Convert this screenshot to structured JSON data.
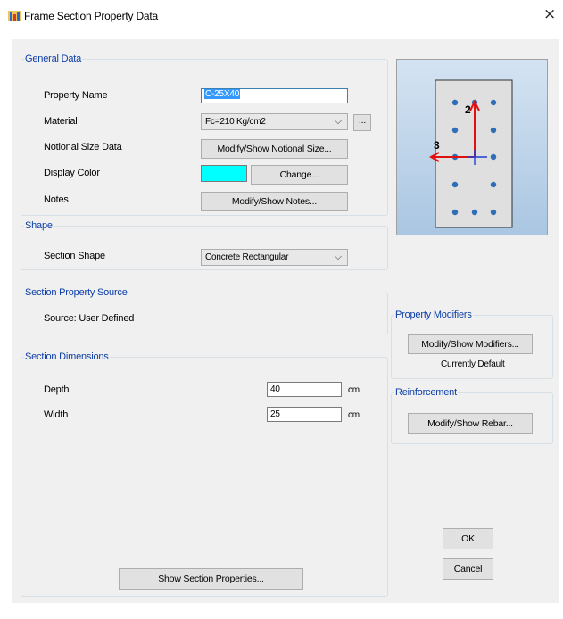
{
  "window": {
    "title": "Frame Section Property Data",
    "close": "×"
  },
  "general": {
    "legend": "General Data",
    "property_name_label": "Property Name",
    "property_name_value": "C-25X40",
    "material_label": "Material",
    "material_value": "Fc=210 Kg/cm2",
    "material_more": "...",
    "notional_label": "Notional Size Data",
    "notional_button": "Modify/Show Notional Size...",
    "display_color_label": "Display Color",
    "display_color_value": "#00ffff",
    "change_button": "Change...",
    "notes_label": "Notes",
    "notes_button": "Modify/Show Notes..."
  },
  "shape": {
    "legend": "Shape",
    "section_shape_label": "Section Shape",
    "section_shape_value": "Concrete Rectangular"
  },
  "source": {
    "legend": "Section Property Source",
    "text": "Source:  User Defined"
  },
  "dimensions": {
    "legend": "Section Dimensions",
    "depth_label": "Depth",
    "depth_value": "40",
    "depth_unit": "cm",
    "width_label": "Width",
    "width_value": "25",
    "width_unit": "cm",
    "show_properties_button": "Show Section Properties..."
  },
  "preview": {
    "axis_2_label": "2",
    "axis_3_label": "3",
    "colors": {
      "axis_2": "#e01010",
      "axis_3": "#e01010",
      "rebar": "#2e6db8",
      "origin": "#1f3fd1"
    }
  },
  "modifiers": {
    "legend": "Property Modifiers",
    "button": "Modify/Show Modifiers...",
    "status": "Currently Default"
  },
  "reinforcement": {
    "legend": "Reinforcement",
    "button": "Modify/Show Rebar..."
  },
  "footer": {
    "ok": "OK",
    "cancel": "Cancel"
  }
}
